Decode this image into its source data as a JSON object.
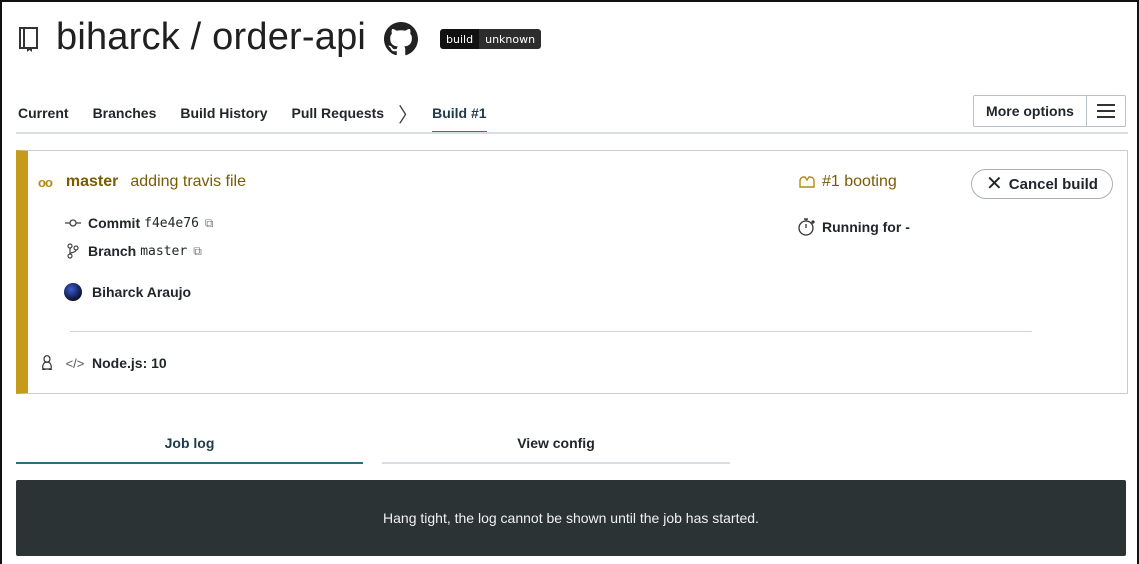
{
  "header": {
    "repo_title": "biharck / order-api",
    "badge": {
      "left": "build",
      "right": "unknown"
    }
  },
  "nav": {
    "tabs": [
      "Current",
      "Branches",
      "Build History",
      "Pull Requests"
    ],
    "active_tab": "Build #1",
    "more_options": "More options"
  },
  "build": {
    "branch": "master",
    "commit_message": "adding travis file",
    "commit_label": "Commit",
    "commit_sha": "f4e4e76",
    "branch_label": "Branch",
    "branch_value": "master",
    "author": "Biharck Araujo",
    "status": "#1 booting",
    "running": "Running for -",
    "cancel": "Cancel build",
    "env": "Node.js: 10",
    "status_color": "#c69b1b"
  },
  "log": {
    "tab_job": "Job log",
    "tab_config": "View config",
    "message": "Hang tight, the log cannot be shown until the job has started."
  }
}
